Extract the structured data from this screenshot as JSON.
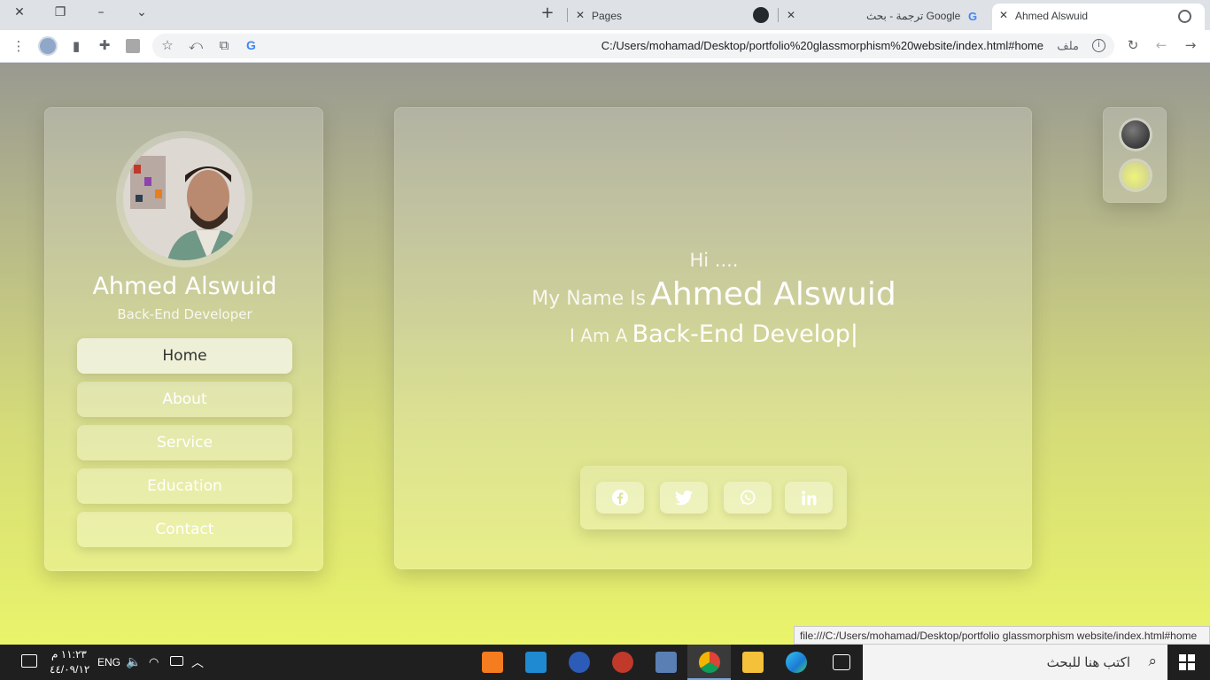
{
  "browser": {
    "tabs": [
      {
        "title": "Pages"
      },
      {
        "title": "ترجمة - بحث Google"
      },
      {
        "title": "Ahmed Alswuid"
      }
    ],
    "url": "C:/Users/mohamad/Desktop/portfolio%20glassmorphism%20website/index.html#home",
    "file_label": "ملف",
    "status_url": "file:///C:/Users/mohamad/Desktop/portfolio glassmorphism website/index.html#home"
  },
  "sidebar": {
    "name": "Ahmed Alswuid",
    "role": "Back-End Developer",
    "nav": [
      {
        "label": "Home",
        "active": true
      },
      {
        "label": "About"
      },
      {
        "label": "Service"
      },
      {
        "label": "Education"
      },
      {
        "label": "Contact"
      }
    ]
  },
  "hero": {
    "greeting": "Hi ....",
    "name_prefix": "My Name Is",
    "name": "Ahmed Alswuid",
    "role_prefix": "I Am A",
    "role_typed": "Back-End Develop|"
  },
  "social": [
    "facebook-icon",
    "twitter-icon",
    "whatsapp-icon",
    "linkedin-icon"
  ],
  "taskbar": {
    "time": "١١:٢٣ م",
    "date": "٤٤/٠٩/١٢",
    "language": "ENG",
    "search_placeholder": "اكتب هنا للبحث"
  },
  "colors": {
    "page_top": "#999a90",
    "page_bottom": "#eaf46a",
    "taskbar": "#1f1f1f"
  }
}
